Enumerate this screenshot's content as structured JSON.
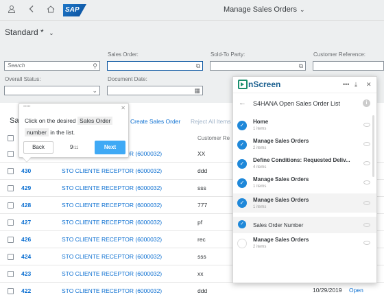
{
  "shell": {
    "title": "Manage Sales Orders",
    "logo_text": "SAP",
    "icons": [
      "person-icon",
      "back-icon",
      "home-icon",
      "chevron-down-icon"
    ]
  },
  "filterbar": {
    "variant": "Standard *",
    "search_placeholder": "Search",
    "labels": {
      "sales_order": "Sales Order:",
      "sold_to": "Sold-To Party:",
      "customer_ref": "Customer Reference:",
      "overall_status": "Overall Status:",
      "document_date": "Document Date:"
    }
  },
  "table": {
    "title_partial": "Sa",
    "actions": {
      "create": "Create Sales Order",
      "reject": "Reject All Items"
    },
    "columns": {
      "customer_ref": "Customer Re"
    },
    "rows": [
      {
        "id": "",
        "customer": "STO CLIENTE RECEPTOR (6000032)",
        "ref": "XX"
      },
      {
        "id": "430",
        "customer": "STO CLIENTE RECEPTOR (6000032)",
        "ref": "ddd"
      },
      {
        "id": "429",
        "customer": "STO CLIENTE RECEPTOR (6000032)",
        "ref": "sss"
      },
      {
        "id": "428",
        "customer": "STO CLIENTE RECEPTOR (6000032)",
        "ref": "777"
      },
      {
        "id": "427",
        "customer": "STO CLIENTE RECEPTOR (6000032)",
        "ref": "pf"
      },
      {
        "id": "426",
        "customer": "STO CLIENTE RECEPTOR (6000032)",
        "ref": "rec"
      },
      {
        "id": "424",
        "customer": "STO CLIENTE RECEPTOR (6000032)",
        "ref": "sss"
      },
      {
        "id": "423",
        "customer": "STO CLIENTE RECEPTOR (6000032)",
        "ref": "xx"
      },
      {
        "id": "422",
        "customer": "STO CLIENTE RECEPTOR (6000032)",
        "ref": "ddd"
      }
    ],
    "last_row_date": "10/29/2019",
    "last_row_status": "Open"
  },
  "tooltip": {
    "text_before": "Click on the desired",
    "highlight_1": "Sales Order",
    "highlight_2": "number",
    "text_after": "in the list.",
    "back": "Back",
    "step": "9",
    "total": "/11",
    "next": "Next"
  },
  "panel": {
    "brand": "nScreen",
    "subtitle": "S4HANA Open Sales Order List",
    "steps": [
      {
        "title": "Home",
        "sub": "1 items",
        "done": true
      },
      {
        "title": "Manage Sales Orders",
        "sub": "2 items",
        "done": true
      },
      {
        "title": "Define Conditions: Requested Deliv...",
        "sub": "4 items",
        "done": true
      },
      {
        "title": "Manage Sales Orders",
        "sub": "1 items",
        "done": true
      },
      {
        "title": "Manage Sales Orders",
        "sub": "1 items",
        "done": true
      },
      {
        "title": "Sales Order Number",
        "sub": "",
        "done": true
      },
      {
        "title": "Manage Sales Orders",
        "sub": "2 items",
        "done": false
      }
    ]
  }
}
